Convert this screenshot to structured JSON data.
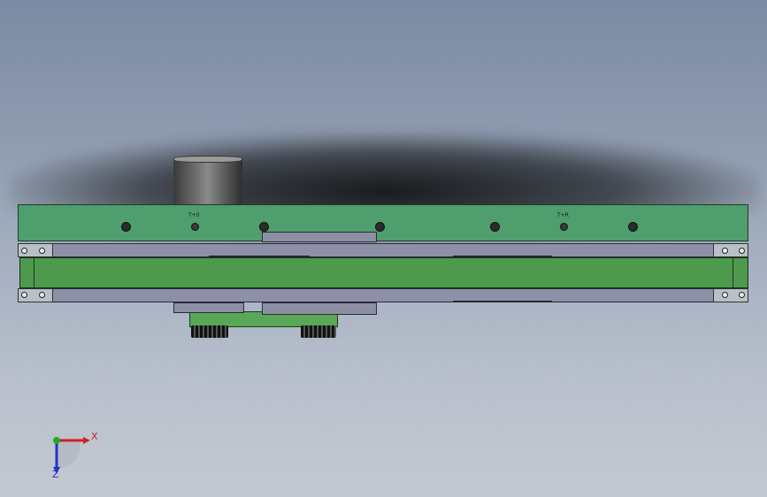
{
  "viewport": {
    "background_top": "#7c8ba4",
    "background_bottom": "#c3c9d2"
  },
  "model": {
    "plate_engrave_left": "T+0",
    "plate_engrave_right": "T+R",
    "plate_color": "#4f9e6e",
    "beam_color": "#4d9a4d",
    "rail_color": "#8e90a8"
  },
  "triad": {
    "x_label": "X",
    "z_label": "Z",
    "x_color": "#cc2222",
    "y_color": "#22aa22",
    "z_color": "#2233cc"
  }
}
